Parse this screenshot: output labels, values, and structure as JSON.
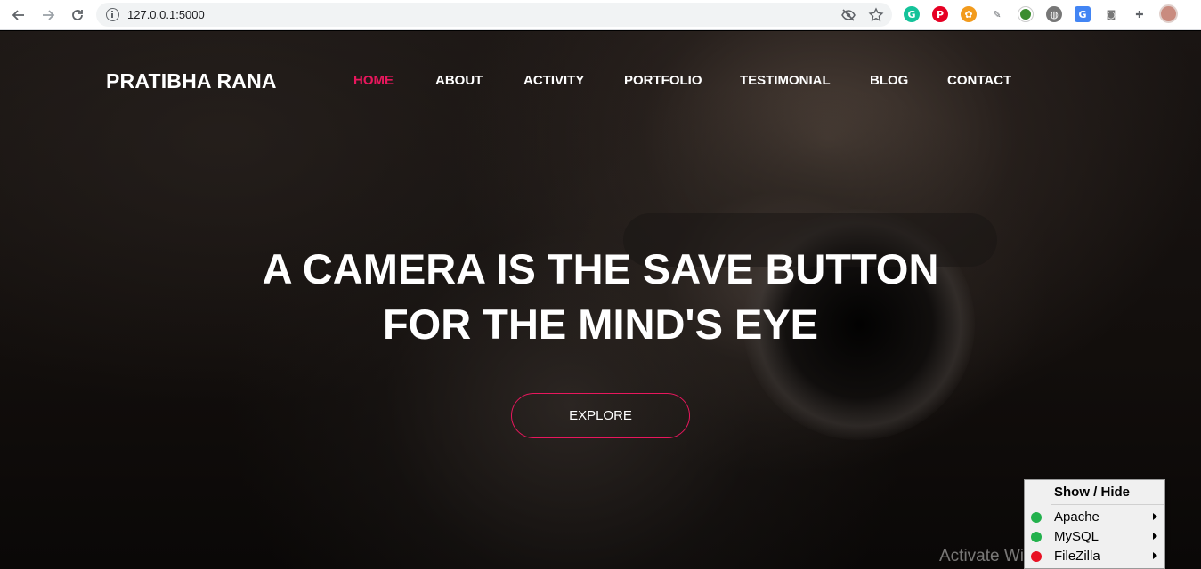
{
  "browser": {
    "url": "127.0.0.1:5000"
  },
  "site": {
    "brand": "PRATIBHA RANA",
    "accent_color": "#e8175d",
    "nav": [
      {
        "label": "HOME",
        "active": true
      },
      {
        "label": "ABOUT",
        "active": false
      },
      {
        "label": "ACTIVITY",
        "active": false
      },
      {
        "label": "PORTFOLIO",
        "active": false
      },
      {
        "label": "TESTIMONIAL",
        "active": false
      },
      {
        "label": "BLOG",
        "active": false
      },
      {
        "label": "CONTACT",
        "active": false
      }
    ],
    "headline_line1": "A CAMERA IS THE SAVE BUTTON",
    "headline_line2": "FOR THE MIND'S EYE",
    "cta": "EXPLORE"
  },
  "overlay": {
    "watermark": "Activate Windows"
  },
  "tray_menu": {
    "title": "Show / Hide",
    "items": [
      {
        "label": "Apache",
        "status_color": "#22b14c"
      },
      {
        "label": "MySQL",
        "status_color": "#22b14c"
      },
      {
        "label": "FileZilla",
        "status_color": "#e81123"
      }
    ]
  }
}
